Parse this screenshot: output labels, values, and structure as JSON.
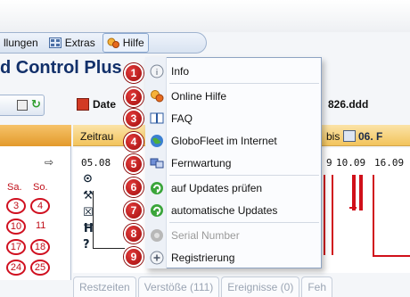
{
  "menubar": {
    "items": [
      {
        "label": "llungen",
        "icon": "none"
      },
      {
        "label": "Extras",
        "icon": "grid-icon"
      },
      {
        "label": "Hilfe",
        "icon": "help-icon"
      }
    ]
  },
  "app": {
    "title": "d Control Plus"
  },
  "toolbar": {
    "date_label": "Date",
    "file_label": "826.ddd"
  },
  "timeline": {
    "zeit_label": "Zeitrau",
    "bis_label": "bis",
    "date_field": "06. F",
    "ticks": [
      "05.08",
      "9",
      "10.09",
      "16.09"
    ],
    "row_icons": [
      "target-icon",
      "tools-icon",
      "box-icon",
      "bed-icon",
      "question-icon"
    ]
  },
  "calendar": {
    "arrow": "⇨",
    "headers": [
      "Sa.",
      "So."
    ],
    "rows": [
      [
        "3",
        "4"
      ],
      [
        "10",
        "11"
      ],
      [
        "17",
        "18"
      ],
      [
        "24",
        "25"
      ]
    ]
  },
  "bottom_tabs": [
    "Restzeiten",
    "Verstöße (111)",
    "Ereignisse (0)",
    "Feh"
  ],
  "help_menu": {
    "items": [
      {
        "badge": "1",
        "label": "Info",
        "icon": "info-icon",
        "enabled": true
      },
      {
        "badge": "2",
        "label": "Online Hilfe",
        "icon": "help-icon",
        "enabled": true
      },
      {
        "badge": "3",
        "label": "FAQ",
        "icon": "book-icon",
        "enabled": true
      },
      {
        "badge": "4",
        "label": "GloboFleet im Internet",
        "icon": "globe-icon",
        "enabled": true
      },
      {
        "badge": "5",
        "label": "Fernwartung",
        "icon": "remote-icon",
        "enabled": true
      },
      {
        "badge": "6",
        "label": "auf Updates prüfen",
        "icon": "update-icon",
        "enabled": true
      },
      {
        "badge": "7",
        "label": "automatische Updates",
        "icon": "update-icon",
        "enabled": true
      },
      {
        "badge": "8",
        "label": "Serial Number",
        "icon": "serial-icon",
        "enabled": false
      },
      {
        "badge": "9",
        "label": "Registrierung",
        "icon": "register-icon",
        "enabled": true
      }
    ]
  },
  "colors": {
    "accent": "#d0101a",
    "menu_border": "#8da3c2",
    "title_blue": "#12306a",
    "header_orange": "#f2c45c"
  }
}
